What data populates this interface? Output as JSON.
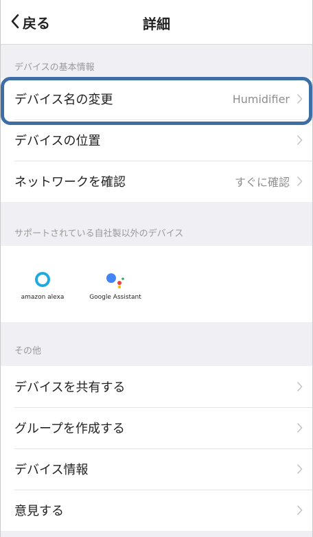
{
  "header": {
    "back_label": "戻る",
    "title": "詳細"
  },
  "sections": {
    "basic": {
      "header": "デバイスの基本情報",
      "rows": [
        {
          "label": "デバイス名の変更",
          "value": "Humidifier"
        },
        {
          "label": "デバイスの位置",
          "value": ""
        },
        {
          "label": "ネットワークを確認",
          "value": "すぐに確認"
        }
      ]
    },
    "support": {
      "header": "サポートされている自社製以外のデバイス",
      "partners": [
        {
          "name": "amazon alexa",
          "icon": "alexa-icon"
        },
        {
          "name": "Google Assistant",
          "icon": "google-assistant-icon"
        }
      ]
    },
    "other": {
      "header": "その他",
      "rows": [
        {
          "label": "デバイスを共有する"
        },
        {
          "label": "グループを作成する"
        },
        {
          "label": "デバイス情報"
        },
        {
          "label": "意見する"
        }
      ]
    }
  },
  "colors": {
    "highlight": "#3d6ea6",
    "background": "#efeff4",
    "google_blue": "#4285f4",
    "google_red": "#ea4335",
    "google_yellow": "#fbbc05",
    "google_green": "#34a853",
    "alexa": "#1fa9e1"
  }
}
